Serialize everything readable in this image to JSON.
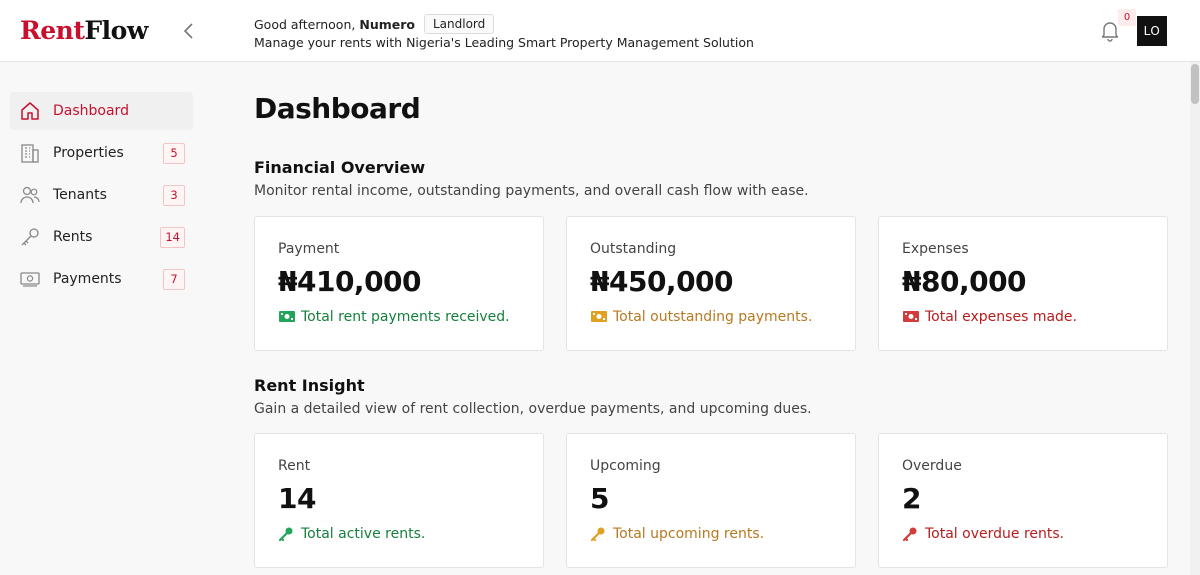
{
  "header": {
    "logo_part1": "Rent",
    "logo_part2": "Flow",
    "greeting": "Good afternoon,",
    "user_name": "Numero",
    "role": "Landlord",
    "subtitle": "Manage your rents with Nigeria's Leading Smart Property Management Solution",
    "notification_count": "0",
    "avatar_initials": "LO"
  },
  "sidebar": {
    "items": [
      {
        "label": "Dashboard",
        "icon": "home-icon",
        "count": null
      },
      {
        "label": "Properties",
        "icon": "building-icon",
        "count": "5"
      },
      {
        "label": "Tenants",
        "icon": "users-icon",
        "count": "3"
      },
      {
        "label": "Rents",
        "icon": "key-icon",
        "count": "14"
      },
      {
        "label": "Payments",
        "icon": "money-icon",
        "count": "7"
      }
    ]
  },
  "main": {
    "title": "Dashboard",
    "financial": {
      "title": "Financial Overview",
      "description": "Monitor rental income, outstanding payments, and overall cash flow with ease.",
      "cards": [
        {
          "label": "Payment",
          "value": "₦410,000",
          "note": "Total rent payments received.",
          "color": "#15803d"
        },
        {
          "label": "Outstanding",
          "value": "₦450,000",
          "note": "Total outstanding payments.",
          "color": "#b7791f"
        },
        {
          "label": "Expenses",
          "value": "₦80,000",
          "note": "Total expenses made.",
          "color": "#b91c1c"
        }
      ]
    },
    "insight": {
      "title": "Rent Insight",
      "description": "Gain a detailed view of rent collection, overdue payments, and upcoming dues.",
      "cards": [
        {
          "label": "Rent",
          "value": "14",
          "note": "Total active rents.",
          "color": "#15803d"
        },
        {
          "label": "Upcoming",
          "value": "5",
          "note": "Total upcoming rents.",
          "color": "#b7791f"
        },
        {
          "label": "Overdue",
          "value": "2",
          "note": "Total overdue rents.",
          "color": "#b91c1c"
        }
      ]
    }
  },
  "colors": {
    "brand": "#c8102e",
    "positive": "#15803d",
    "warning": "#b7791f",
    "negative": "#b91c1c"
  }
}
